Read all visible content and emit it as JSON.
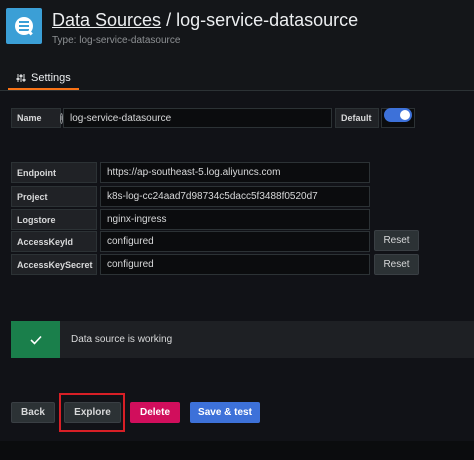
{
  "header": {
    "title_link": "Data Sources",
    "title_separator": " / ",
    "title_name": "log-service-datasource",
    "subtitle": "Type: log-service-datasource"
  },
  "tabs": [
    {
      "label": "Settings",
      "icon": "sliders-icon"
    }
  ],
  "form": {
    "name_label": "Name",
    "name_value": "log-service-datasource",
    "default_label": "Default",
    "default_on": true,
    "fields": [
      {
        "label": "Endpoint",
        "value": "https://ap-southeast-5.log.aliyuncs.com"
      },
      {
        "label": "Project",
        "value": "k8s-log-cc24aad7d98734c5dacc5f3488f0520d7"
      },
      {
        "label": "Logstore",
        "value": "nginx-ingress"
      },
      {
        "label": "AccessKeyId",
        "value": "configured",
        "action": "Reset"
      },
      {
        "label": "AccessKeySecret",
        "value": "configured",
        "action": "Reset"
      }
    ]
  },
  "alert": {
    "text": "Data source is working",
    "icon": "check-icon",
    "color": "#1a7f4b"
  },
  "actions": {
    "back": "Back",
    "explore": "Explore",
    "delete": "Delete",
    "save": "Save & test"
  },
  "colors": {
    "accent": "#3d71d9",
    "danger": "#d10e5c",
    "tab_underline": "#f97316",
    "highlight": "#d81f26"
  }
}
